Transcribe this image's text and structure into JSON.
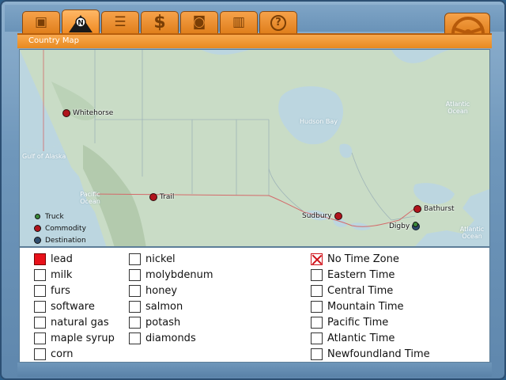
{
  "window": {
    "panel_title": "Country Map"
  },
  "toolbar": {
    "tabs": [
      {
        "icon": "briefcase-icon",
        "glyph": "▣"
      },
      {
        "icon": "compass-icon",
        "glyph": "N"
      },
      {
        "icon": "clipboard-icon",
        "glyph": "☰"
      },
      {
        "icon": "dollar-icon",
        "glyph": "$"
      },
      {
        "icon": "camera-icon",
        "glyph": "◙"
      },
      {
        "icon": "book-icon",
        "glyph": "▥"
      },
      {
        "icon": "help-icon",
        "glyph": "?"
      }
    ],
    "wheel_icon": "steering-wheel-icon"
  },
  "map": {
    "water_labels": [
      "Hudson Bay",
      "Gulf of Alaska",
      "Pacific Ocean",
      "Atlantic Ocean",
      "Atlantic Ocean"
    ],
    "cities": {
      "whitehorse": "Whitehorse",
      "trail": "Trail",
      "sudbury": "Sudbury",
      "bathurst": "Bathurst",
      "digby": "Digby"
    },
    "legend": {
      "truck": "Truck",
      "commodity": "Commodity",
      "destination": "Destination"
    },
    "colors": {
      "truck": "#3a8a3a",
      "commodity": "#b0141c",
      "destination": "#2f4d6e",
      "land": "#c9dcc6",
      "water": "#bcd6e0"
    }
  },
  "commodities": {
    "col1": [
      {
        "label": "lead",
        "checked": true
      },
      {
        "label": "milk",
        "checked": false
      },
      {
        "label": "furs",
        "checked": false
      },
      {
        "label": "software",
        "checked": false
      },
      {
        "label": "natural gas",
        "checked": false
      },
      {
        "label": "maple syrup",
        "checked": false
      },
      {
        "label": "corn",
        "checked": false
      }
    ],
    "col2": [
      {
        "label": "nickel",
        "checked": false
      },
      {
        "label": "molybdenum",
        "checked": false
      },
      {
        "label": "honey",
        "checked": false
      },
      {
        "label": "salmon",
        "checked": false
      },
      {
        "label": "potash",
        "checked": false
      },
      {
        "label": "diamonds",
        "checked": false
      }
    ]
  },
  "time_zones": [
    {
      "label": "No Time Zone",
      "checked": true
    },
    {
      "label": "Eastern Time",
      "checked": false
    },
    {
      "label": "Central Time",
      "checked": false
    },
    {
      "label": "Mountain Time",
      "checked": false
    },
    {
      "label": "Pacific Time",
      "checked": false
    },
    {
      "label": "Atlantic Time",
      "checked": false
    },
    {
      "label": "Newfoundland Time",
      "checked": false
    }
  ]
}
